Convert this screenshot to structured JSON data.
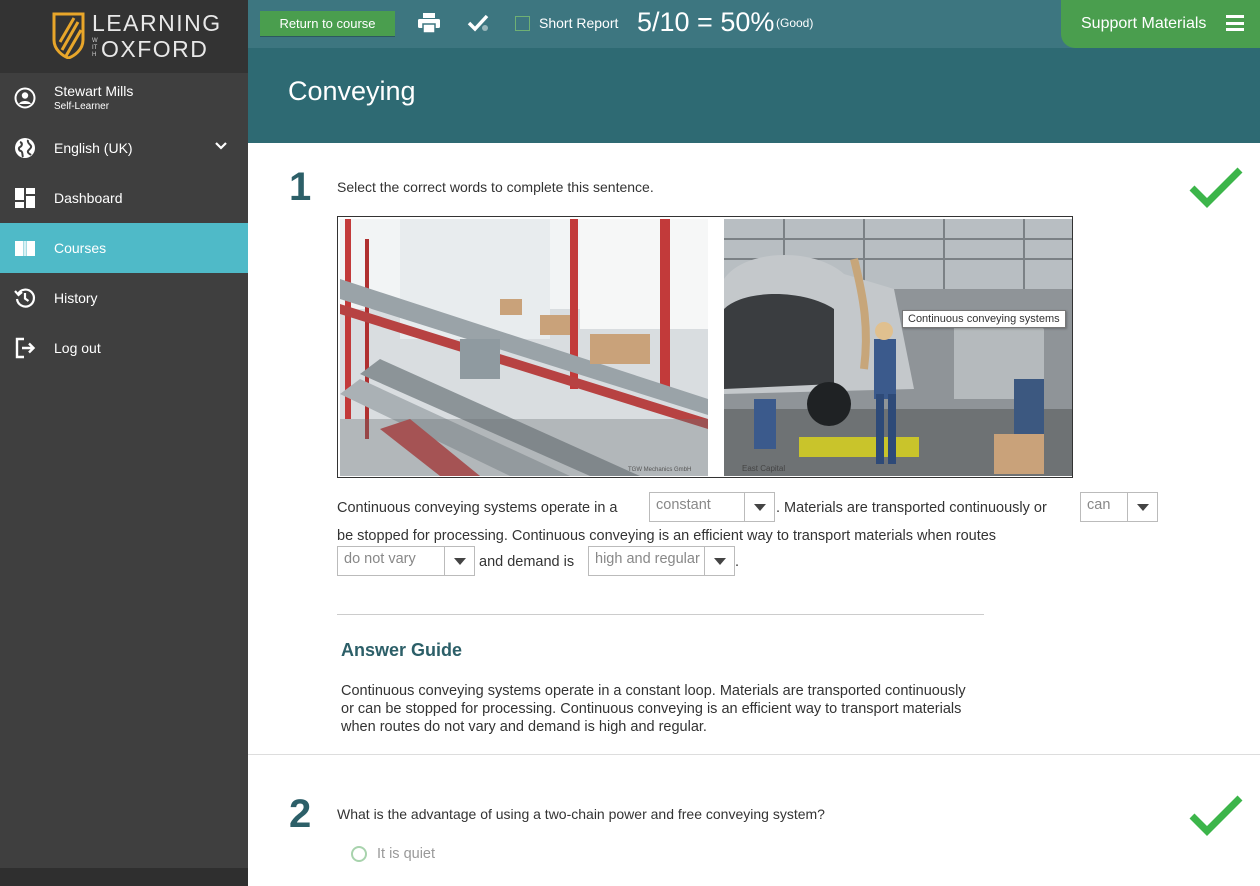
{
  "logo": {
    "line1": "LEARNING",
    "with": "WITH",
    "line2": "OXFORD"
  },
  "user": {
    "name": "Stewart Mills",
    "role": "Self-Learner"
  },
  "sidebar": {
    "items": [
      {
        "label": "English (UK)",
        "icon": "globe-icon"
      },
      {
        "label": "Dashboard",
        "icon": "dashboard-icon"
      },
      {
        "label": "Courses",
        "icon": "book-icon",
        "active": true
      },
      {
        "label": "History",
        "icon": "history-icon"
      },
      {
        "label": "Log out",
        "icon": "logout-icon"
      }
    ]
  },
  "toolbar": {
    "return_label": "Return to course",
    "short_report_label": "Short Report",
    "score": "5/10 = 50%",
    "score_label": "(Good)",
    "support_label": "Support Materials"
  },
  "page": {
    "title": "Conveying"
  },
  "question1": {
    "number": "1",
    "prompt": "Select the correct words to complete this sentence.",
    "tooltip": "Continuous conveying systems",
    "photo_credit_left": "TGW Mechanics GmbH",
    "photo_credit_right": "East Capital",
    "line1_a": "Continuous conveying systems operate in a",
    "select1": "constant",
    "line1_b": ". Materials are transported continuously or",
    "select2": "can",
    "line2": "be stopped for processing. Continuous conveying is an efficient way to transport materials when routes",
    "select3": "do not vary",
    "line3_a": "and demand is",
    "select4": "high and regular",
    "line3_b": ".",
    "answer_title": "Answer Guide",
    "answer_text": "Continuous conveying systems operate in a constant loop. Materials are transported continuously or can be stopped for processing. Continuous conveying is an efficient way to transport materials when routes do not vary and demand is high and regular."
  },
  "question2": {
    "number": "2",
    "prompt": "What is the advantage of using a two-chain power and free conveying system?",
    "option1": "It is quiet"
  },
  "colors": {
    "sidebar": "#3f3f3f",
    "active": "#4fbac8",
    "topbar": "#3d7680",
    "title_band": "#2e6a73",
    "green": "#4a9e4e",
    "check": "#3cb54a"
  }
}
